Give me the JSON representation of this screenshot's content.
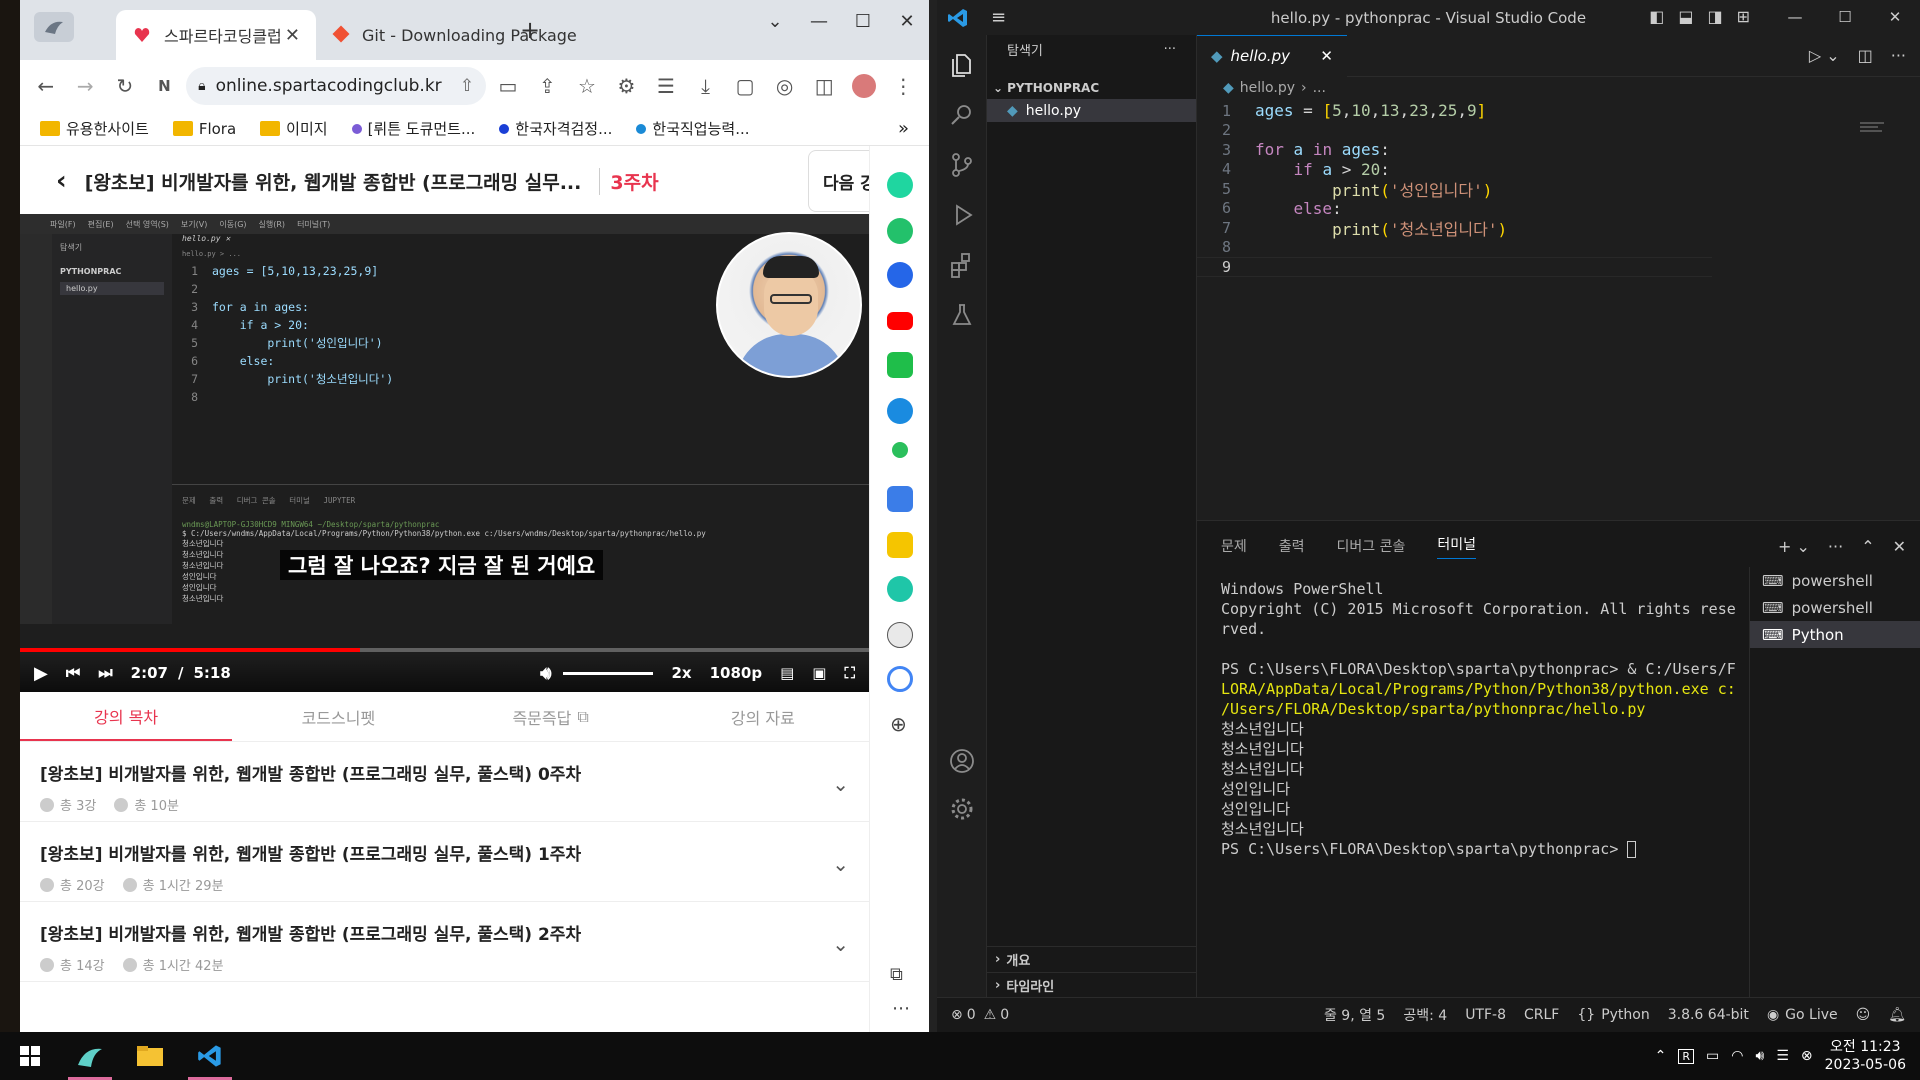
{
  "chrome": {
    "tabs": [
      {
        "title": "스파르타코딩클럽",
        "active": true
      },
      {
        "title": "Git - Downloading Package",
        "active": false
      }
    ],
    "new_tab": "+",
    "url": "online.spartacodingclub.kr",
    "bookmarks": [
      "유용한사이트",
      "Flora",
      "이미지",
      "[뤼튼 도큐먼트...",
      "한국자격검정...",
      "한국직업능력..."
    ],
    "bookmarks_more": "»"
  },
  "course": {
    "title": "[왕초보] 비개발자를 위한, 웹개발 종합반 (프로그래밍 실무...",
    "week": "3주차",
    "next": "다음 강",
    "video": {
      "subtitle": "그럼 잘 나오죠? 지금 잘 된 거예요",
      "time_current": "2:07",
      "time_sep": "/",
      "time_total": "5:18",
      "progress": 0.4,
      "speed": "2x",
      "quality": "1080p",
      "inner_code": [
        {
          "n": "1",
          "t": "ages = [5,10,13,23,25,9]"
        },
        {
          "n": "2",
          "t": ""
        },
        {
          "n": "3",
          "t": "for a in ages:"
        },
        {
          "n": "4",
          "t": "    if a > 20:"
        },
        {
          "n": "5",
          "t": "        print('성인입니다')"
        },
        {
          "n": "6",
          "t": "    else:"
        },
        {
          "n": "7",
          "t": "        print('청소년입니다')"
        },
        {
          "n": "8",
          "t": ""
        }
      ]
    },
    "tabs": [
      "강의 목차",
      "코드스니펫",
      "즉문즉답",
      "강의 자료"
    ],
    "weeks": [
      {
        "title": "[왕초보] 비개발자를 위한, 웹개발 종합반 (프로그래밍 실무, 풀스택) 0주차",
        "lectures": "총 3강",
        "duration": "총 10분"
      },
      {
        "title": "[왕초보] 비개발자를 위한, 웹개발 종합반 (프로그래밍 실무, 풀스택) 1주차",
        "lectures": "총 20강",
        "duration": "총 1시간 29분"
      },
      {
        "title": "[왕초보] 비개발자를 위한, 웹개발 종합반 (프로그래밍 실무, 풀스택) 2주차",
        "lectures": "총 14강",
        "duration": "총 1시간 42분"
      }
    ]
  },
  "vscode": {
    "window_title": "hello.py - pythonprac - Visual Studio Code",
    "explorer_label": "탐색기",
    "explorer_more": "···",
    "folder": "PYTHONPRAC",
    "file": "hello.py",
    "outline": "개요",
    "timeline": "타임라인",
    "tab": "hello.py",
    "breadcrumb_file": "hello.py",
    "breadcrumb_more": "...",
    "code": [
      {
        "n": "1",
        "html": "<span style='color:#9cdcfe'>ages</span> <span style='color:#d4d4d4'>=</span> <span style='color:#ffd700'>[</span><span style='color:#b5cea8'>5</span>,<span style='color:#b5cea8'>10</span>,<span style='color:#b5cea8'>13</span>,<span style='color:#b5cea8'>23</span>,<span style='color:#b5cea8'>25</span>,<span style='color:#b5cea8'>9</span><span style='color:#ffd700'>]</span>"
      },
      {
        "n": "2",
        "html": ""
      },
      {
        "n": "3",
        "html": "<span style='color:#c586c0'>for</span> <span style='color:#9cdcfe'>a</span> <span style='color:#c586c0'>in</span> <span style='color:#9cdcfe'>ages</span>:"
      },
      {
        "n": "4",
        "html": "    <span style='color:#c586c0'>if</span> <span style='color:#9cdcfe'>a</span> &gt; <span style='color:#b5cea8'>20</span>:"
      },
      {
        "n": "5",
        "html": "        <span style='color:#dcdcaa'>print</span><span style='color:#ffd700'>(</span><span style='color:#ce9178'>'성인입니다'</span><span style='color:#ffd700'>)</span>"
      },
      {
        "n": "6",
        "html": "    <span style='color:#c586c0'>else</span>:"
      },
      {
        "n": "7",
        "html": "        <span style='color:#dcdcaa'>print</span><span style='color:#ffd700'>(</span><span style='color:#ce9178'>'청소년입니다'</span><span style='color:#ffd700'>)</span>"
      },
      {
        "n": "8",
        "html": ""
      },
      {
        "n": "9",
        "html": ""
      }
    ],
    "panel_tabs": [
      "문제",
      "출력",
      "디버그 콘솔",
      "터미널"
    ],
    "terminal_lines": [
      "Windows PowerShell",
      "Copyright (C) 2015 Microsoft Corporation. All rights rese",
      "rved.",
      "",
      "PS C:\\Users\\FLORA\\Desktop\\sparta\\pythonprac> & C:/Users/F",
      "LORA/AppData/Local/Programs/Python/Python38/python.exe c:",
      "/Users/FLORA/Desktop/sparta/pythonprac/hello.py",
      "청소년입니다",
      "청소년입니다",
      "청소년입니다",
      "성인입니다",
      "성인입니다",
      "청소년입니다",
      "PS C:\\Users\\FLORA\\Desktop\\sparta\\pythonprac> "
    ],
    "terminals": [
      {
        "name": "powershell",
        "selected": false
      },
      {
        "name": "powershell",
        "selected": false
      },
      {
        "name": "Python",
        "selected": true
      }
    ],
    "status": {
      "errors": "0",
      "warnings": "0",
      "position": "줄 9, 열 5",
      "spaces": "공백: 4",
      "encoding": "UTF-8",
      "eol": "CRLF",
      "language": "Python",
      "interpreter": "3.8.6 64-bit",
      "golive": "Go Live"
    }
  },
  "taskbar": {
    "time": "오전 11:23",
    "date": "2023-05-06"
  }
}
